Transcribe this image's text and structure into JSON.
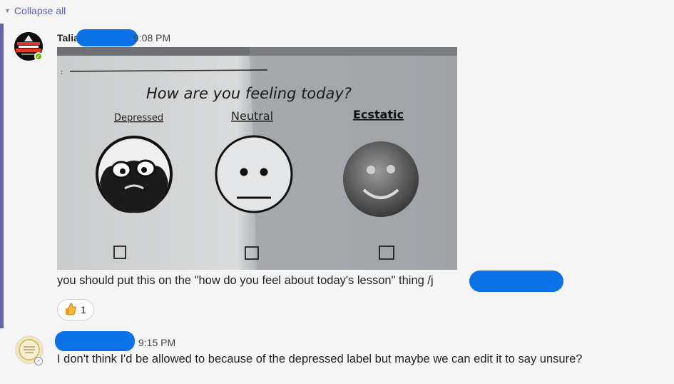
{
  "thread": {
    "collapse_label": "Collapse all"
  },
  "messages": [
    {
      "author": "Talia",
      "time": "9:08 PM",
      "status": "available",
      "image": {
        "prompt": "How are you feeling today?",
        "labels": [
          "Depressed",
          "Neutral",
          "Ecstatic"
        ]
      },
      "text": "you should put this on the \"how do you feel about today's lesson\" thing /j",
      "reaction": {
        "icon": "thumbs-up-icon",
        "count": "1"
      }
    },
    {
      "author": "",
      "time": "9:15 PM",
      "status": "offline",
      "text": "I don't think I'd be allowed to because of the depressed label but maybe we can edit it to say unsure?"
    }
  ],
  "colors": {
    "accent": "#5b5fc7",
    "thread_bar": "#6264a7",
    "redaction": "#0a72e6",
    "available": "#6bb700"
  }
}
